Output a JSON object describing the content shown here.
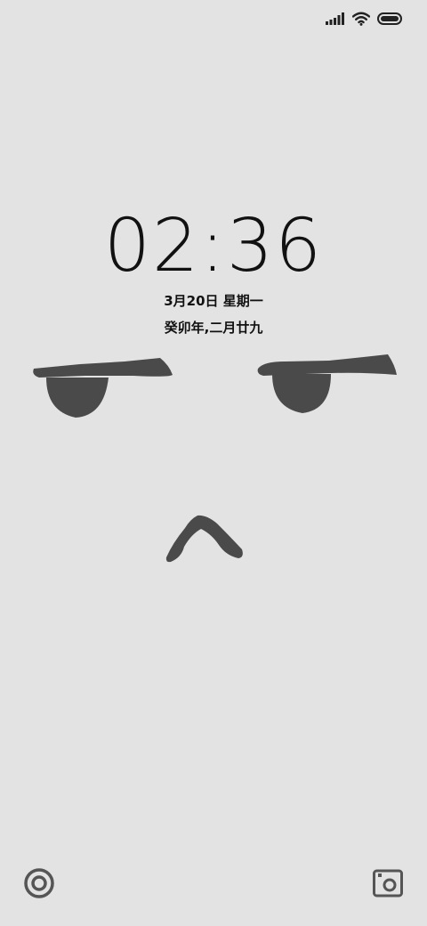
{
  "status_bar": {
    "icons": [
      "signal-bars-icon",
      "wifi-icon",
      "battery-icon"
    ]
  },
  "lockscreen": {
    "time": "02:36",
    "date": "3月20日 星期一",
    "lunar_date": "癸卯年,二月廿九"
  },
  "wallpaper": {
    "description_icons": [
      "left-eye-icon",
      "right-eye-icon",
      "caret-mouth-icon"
    ],
    "ink_color": "#4a4a4a",
    "background_color": "#e3e3e3"
  },
  "shortcuts": {
    "left": "voice-assistant-icon",
    "right": "camera-icon"
  }
}
